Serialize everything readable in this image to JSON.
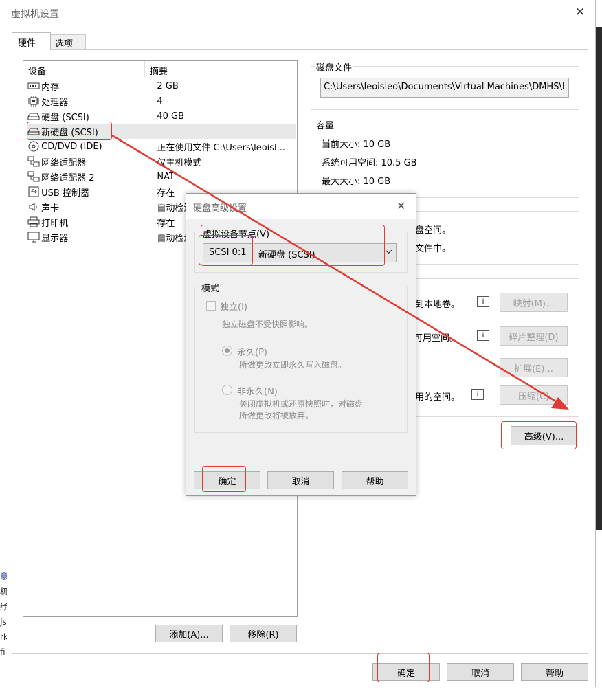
{
  "window": {
    "title": "虚拟机设置",
    "close_glyph": "✕"
  },
  "tabs": [
    {
      "label": "硬件"
    },
    {
      "label": "选项"
    }
  ],
  "device_list": {
    "col_device": "设备",
    "col_summary": "摘要",
    "rows": [
      {
        "icon": "memory-icon",
        "name": "内存",
        "summary": "2 GB"
      },
      {
        "icon": "cpu-icon",
        "name": "处理器",
        "summary": "4"
      },
      {
        "icon": "hard-disk-icon",
        "name": "硬盘 (SCSI)",
        "summary": "40 GB"
      },
      {
        "icon": "hard-disk-icon",
        "name": "新硬盘 (SCSI)",
        "summary": ""
      },
      {
        "icon": "cd-dvd-icon",
        "name": "CD/DVD (IDE)",
        "summary": "正在使用文件 C:\\Users\\leoisl..."
      },
      {
        "icon": "network-adapter-icon",
        "name": "网络适配器",
        "summary": "仅主机模式"
      },
      {
        "icon": "network-adapter-icon",
        "name": "网络适配器 2",
        "summary": "NAT"
      },
      {
        "icon": "usb-icon",
        "name": "USB 控制器",
        "summary": "存在"
      },
      {
        "icon": "sound-card-icon",
        "name": "声卡",
        "summary": "自动检测"
      },
      {
        "icon": "printer-icon",
        "name": "打印机",
        "summary": "存在"
      },
      {
        "icon": "display-icon",
        "name": "显示器",
        "summary": "自动检测"
      }
    ],
    "add_button": "添加(A)...",
    "remove_button": "移除(R)"
  },
  "disk_file": {
    "label": "磁盘文件",
    "path": "C:\\Users\\leoisleo\\Documents\\Virtual Machines\\DMHS\\I"
  },
  "capacity": {
    "label": "容量",
    "current_size": "当前大小: 10 GB",
    "available": "系统可用空间: 10.5 GB",
    "max_size": "最大大小: 10 GB"
  },
  "info": {
    "line1": "盘空间。",
    "line2": "文件中。"
  },
  "utilities": {
    "map_text": "到本地卷。",
    "map_button": "映射(M)...",
    "defrag_text": "可用空间。",
    "defrag_button": "碎片整理(D)",
    "expand_button": "扩展(E)...",
    "compact_text": "用的空间。",
    "compact_button": "压缩(C)",
    "hint_glyph": "i"
  },
  "advanced_button": "高级(V)...",
  "footer": {
    "ok": "确定",
    "cancel": "取消",
    "help": "帮助"
  },
  "dialog": {
    "title": "硬盘高级设置",
    "close_glyph": "✕",
    "node_label": "虚拟设备节点(V)",
    "node_value": "SCSI 0:1",
    "device_value": "新硬盘 (SCSI)",
    "mode_label": "模式",
    "independent": "独立(I)",
    "independent_desc": "独立磁盘不受快照影响。",
    "persistent": "永久(P)",
    "persistent_desc": "所做更改立即永久写入磁盘。",
    "nonpersistent": "非永久(N)",
    "nonpersistent_desc1": "关闭虚拟机或还原快照时，对磁盘",
    "nonpersistent_desc2": "所做更改将被放弃。",
    "ok": "确定",
    "cancel": "取消",
    "help": "帮助"
  },
  "background_fragments": [
    "意",
    "杌",
    "纾",
    "Js",
    "rk",
    "fi"
  ],
  "colors": {
    "annotation": "#e23a35",
    "selection": "#e8e8e8",
    "dialog_bg": "#f0f0f0"
  }
}
